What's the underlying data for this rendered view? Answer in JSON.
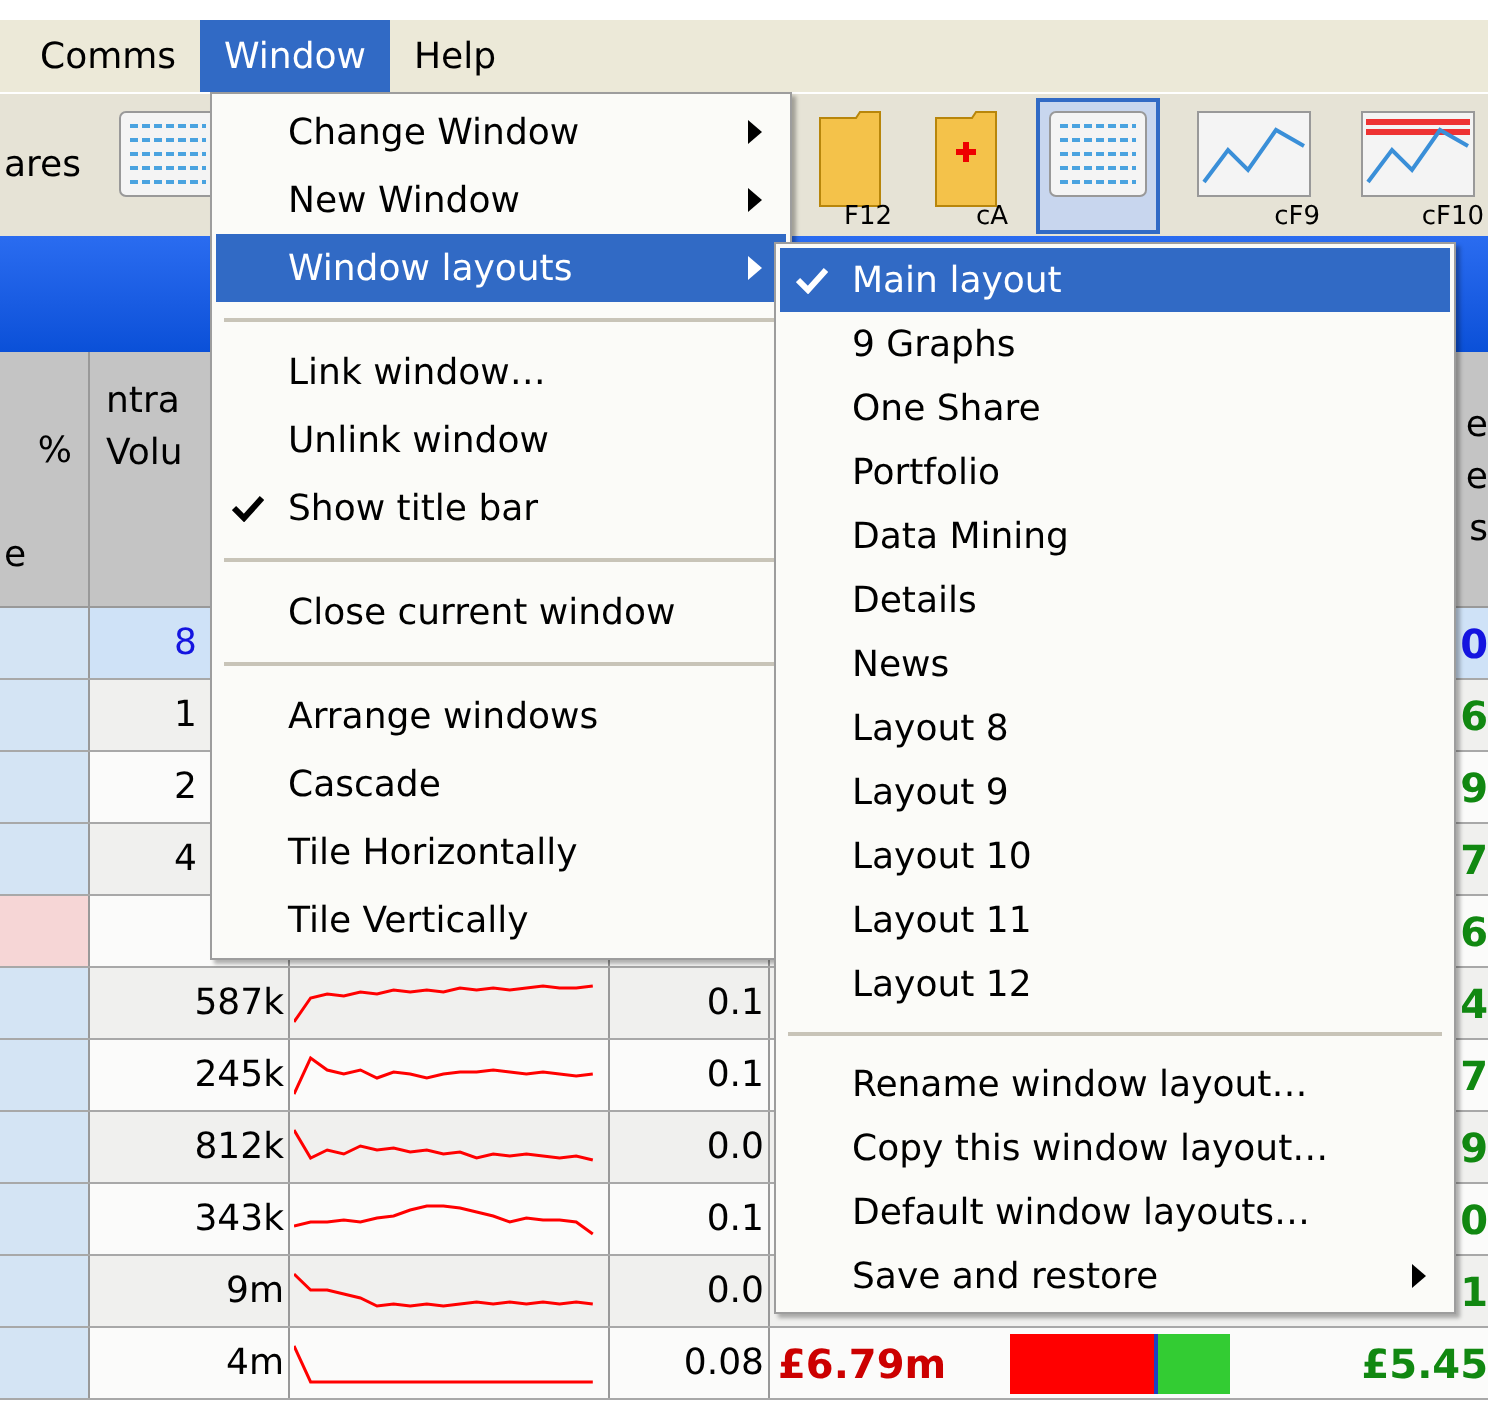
{
  "menubar": [
    {
      "label": "Comms",
      "selected": false
    },
    {
      "label": "Window",
      "selected": true
    },
    {
      "label": "Help",
      "selected": false
    }
  ],
  "toolbar": {
    "label": "ares",
    "buttons": [
      {
        "kind": "list",
        "selected": false
      },
      {
        "kind": "folder",
        "label": "F12",
        "selected": false
      },
      {
        "kind": "folder-red",
        "label": "cA",
        "selected": false
      },
      {
        "kind": "list",
        "selected": true
      },
      {
        "kind": "chart",
        "label": "cF9",
        "selected": false
      },
      {
        "kind": "chart-red",
        "label": "cF10",
        "selected": false
      }
    ]
  },
  "table": {
    "header": {
      "column_1": [
        "%",
        "e"
      ],
      "column_2": [
        "ntra",
        "Volu"
      ],
      "column_7": [
        "e",
        "e",
        "s"
      ]
    },
    "rows": [
      {
        "kind": "covered",
        "selected": true,
        "color": "#d4e4f4",
        "column_2": "8",
        "column_7": "0"
      },
      {
        "kind": "covered",
        "selected": false,
        "color": "#d4e4f4",
        "column_2": "1",
        "column_7": "6"
      },
      {
        "kind": "covered",
        "selected": false,
        "color": "#d4e4f4",
        "column_2": "2",
        "column_7": "9"
      },
      {
        "kind": "covered",
        "selected": false,
        "color": "#d4e4f4",
        "column_2": "4",
        "column_7": "7"
      },
      {
        "kind": "covered",
        "selected": false,
        "color": "#f6d6d6",
        "column_7": "6"
      },
      {
        "kind": "full",
        "selected": false,
        "color": "#d4e4f4",
        "column_2": "587k",
        "column_4": "0.1",
        "column_7": "4"
      },
      {
        "kind": "full",
        "selected": false,
        "color": "#d4e4f4",
        "column_2": "245k",
        "column_4": "0.1",
        "column_7": "7"
      },
      {
        "kind": "full",
        "selected": false,
        "color": "#d4e4f4",
        "column_2": "812k",
        "column_4": "0.0",
        "column_7": "9"
      },
      {
        "kind": "full",
        "selected": false,
        "color": "#d4e4f4",
        "column_2": "343k",
        "column_4": "0.1",
        "column_7": "0"
      },
      {
        "kind": "full",
        "selected": false,
        "color": "#d4e4f4",
        "column_2": "9m",
        "column_4": "0.0",
        "column_7": "1"
      },
      {
        "kind": "full",
        "selected": false,
        "color": "#d4e4f4",
        "column_2": "4m",
        "column_4": "0.08",
        "column_5": "£6.79m",
        "level": 0.67,
        "column_7": "£5.45"
      }
    ]
  },
  "window_menu": [
    {
      "kind": "item",
      "label": "Change Window",
      "checked": false,
      "submenu": true,
      "selected": false
    },
    {
      "kind": "item",
      "label": "New Window",
      "checked": false,
      "submenu": true,
      "selected": false
    },
    {
      "kind": "item",
      "label": "Window layouts",
      "checked": false,
      "submenu": true,
      "selected": true
    },
    {
      "kind": "separator"
    },
    {
      "kind": "item",
      "label": "Link window…",
      "checked": false,
      "submenu": false,
      "selected": false
    },
    {
      "kind": "item",
      "label": "Unlink window",
      "checked": false,
      "submenu": false,
      "selected": false
    },
    {
      "kind": "item",
      "label": "Show title bar",
      "checked": true,
      "submenu": false,
      "selected": false
    },
    {
      "kind": "separator"
    },
    {
      "kind": "item",
      "label": "Close current window",
      "checked": false,
      "submenu": false,
      "selected": false
    },
    {
      "kind": "separator"
    },
    {
      "kind": "item",
      "label": "Arrange windows",
      "checked": false,
      "submenu": false,
      "selected": false
    },
    {
      "kind": "item",
      "label": "Cascade",
      "checked": false,
      "submenu": false,
      "selected": false
    },
    {
      "kind": "item",
      "label": "Tile Horizontally",
      "checked": false,
      "submenu": false,
      "selected": false
    },
    {
      "kind": "item",
      "label": "Tile Vertically",
      "checked": false,
      "submenu": false,
      "selected": false
    }
  ],
  "layouts_submenu": [
    {
      "kind": "item",
      "label": "Main layout",
      "checked": true,
      "submenu": false,
      "selected": true
    },
    {
      "kind": "item",
      "label": "9 Graphs",
      "checked": false,
      "submenu": false,
      "selected": false
    },
    {
      "kind": "item",
      "label": "One Share",
      "checked": false,
      "submenu": false,
      "selected": false
    },
    {
      "kind": "item",
      "label": "Portfolio",
      "checked": false,
      "submenu": false,
      "selected": false
    },
    {
      "kind": "item",
      "label": "Data Mining",
      "checked": false,
      "submenu": false,
      "selected": false
    },
    {
      "kind": "item",
      "label": "Details",
      "checked": false,
      "submenu": false,
      "selected": false
    },
    {
      "kind": "item",
      "label": "News",
      "checked": false,
      "submenu": false,
      "selected": false
    },
    {
      "kind": "item",
      "label": "Layout 8",
      "checked": false,
      "submenu": false,
      "selected": false
    },
    {
      "kind": "item",
      "label": "Layout 9",
      "checked": false,
      "submenu": false,
      "selected": false
    },
    {
      "kind": "item",
      "label": "Layout 10",
      "checked": false,
      "submenu": false,
      "selected": false
    },
    {
      "kind": "item",
      "label": "Layout 11",
      "checked": false,
      "submenu": false,
      "selected": false
    },
    {
      "kind": "item",
      "label": "Layout 12",
      "checked": false,
      "submenu": false,
      "selected": false
    },
    {
      "kind": "separator"
    },
    {
      "kind": "item",
      "label": "Rename window layout…",
      "checked": false,
      "submenu": false,
      "selected": false
    },
    {
      "kind": "item",
      "label": "Copy this window layout…",
      "checked": false,
      "submenu": false,
      "selected": false
    },
    {
      "kind": "item",
      "label": "Default window layouts…",
      "checked": false,
      "submenu": false,
      "selected": false
    },
    {
      "kind": "item",
      "label": "Save and restore",
      "checked": false,
      "submenu": true,
      "selected": false
    }
  ]
}
